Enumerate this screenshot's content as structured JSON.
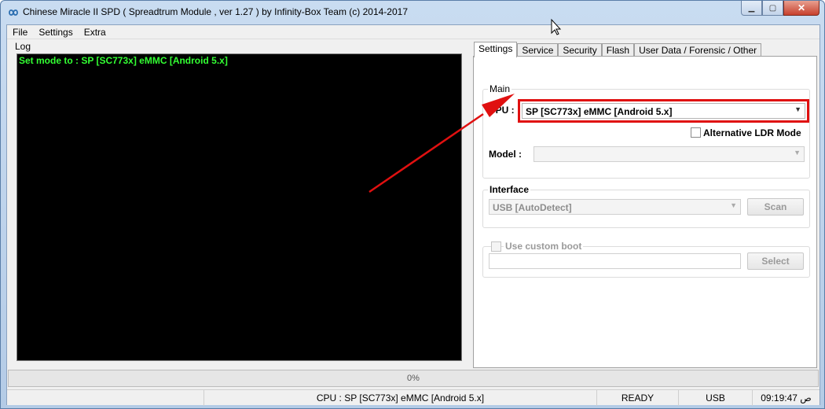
{
  "window": {
    "title": "Chinese Miracle II SPD ( Spreadtrum Module , ver 1.27 ) by Infinity-Box Team (c) 2014-2017",
    "minimize_glyph": "▁",
    "maximize_glyph": "▢",
    "close_glyph": "✕"
  },
  "menu": [
    "File",
    "Settings",
    "Extra"
  ],
  "log": {
    "label": "Log",
    "lines": [
      "Set mode to : SP [SC773x] eMMC [Android 5.x]"
    ]
  },
  "tabs": [
    "Settings",
    "Service",
    "Security",
    "Flash",
    "User Data / Forensic / Other"
  ],
  "settings": {
    "main": {
      "title": "Main",
      "cpu_label": "CPU :",
      "cpu_value": "SP [SC773x] eMMC [Android 5.x]",
      "alt_ldr_label": "Alternative LDR Mode",
      "model_label": "Model :",
      "model_value": ""
    },
    "interface": {
      "title": "Interface",
      "value": "USB [AutoDetect]",
      "scan_label": "Scan"
    },
    "custom_boot": {
      "title": "Use custom boot",
      "path_value": "",
      "select_label": "Select"
    }
  },
  "progress": {
    "value": 0,
    "label": "0%"
  },
  "status": {
    "cpu": "CPU : SP [SC773x] eMMC [Android 5.x]",
    "state": "READY",
    "interface": "USB",
    "time": "09:19:47 ص"
  },
  "colors": {
    "log_text": "#33ff33",
    "highlight": "#e01010",
    "arrow": "#e01010"
  },
  "icons": {
    "app": "infinity-icon",
    "dropdown": "chevron-down-icon",
    "cursor": "mouse-pointer-icon"
  }
}
